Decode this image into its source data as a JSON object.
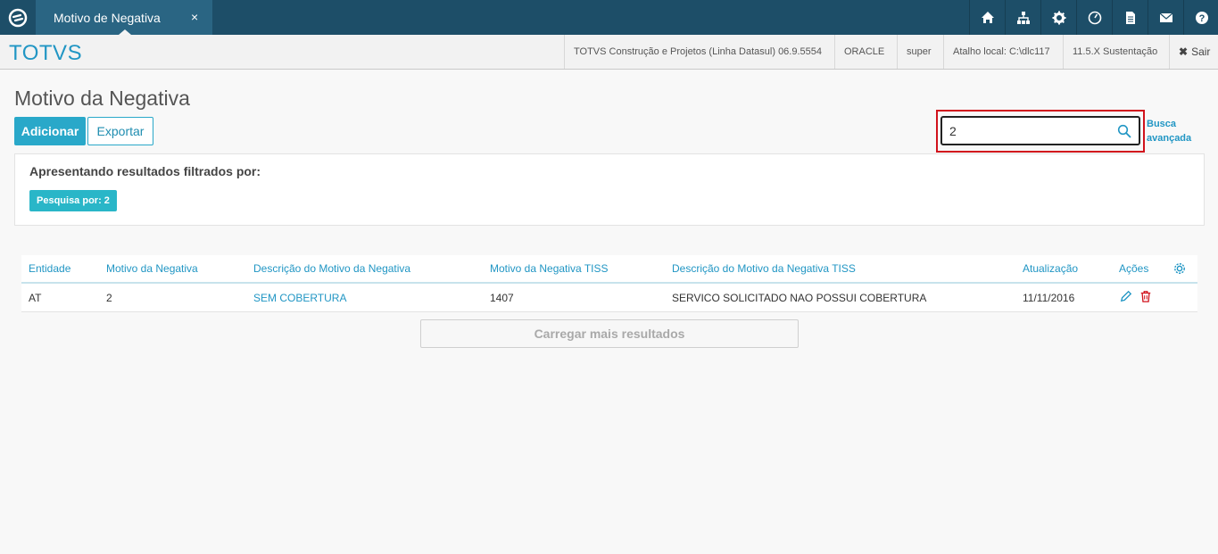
{
  "topbar": {
    "tab_label": "Motivo de Negativa",
    "tab_close": "×",
    "icons": [
      "home-icon",
      "sitemap-icon",
      "gear-icon",
      "dashboard-icon",
      "document-icon",
      "mail-icon",
      "help-icon"
    ]
  },
  "header": {
    "brand": "TOTVS",
    "product": "TOTVS Construção e Projetos (Linha Datasul) 06.9.5554",
    "database": "ORACLE",
    "user": "super",
    "shortcut": "Atalho local: C:\\dlc117",
    "version": "11.5.X Sustentação",
    "logout": "Sair"
  },
  "page": {
    "title": "Motivo da Negativa",
    "add_label": "Adicionar",
    "export_label": "Exportar"
  },
  "search": {
    "value": "2",
    "advanced_line1": "Busca",
    "advanced_line2": "avançada"
  },
  "filter": {
    "title": "Apresentando resultados filtrados por:",
    "badge": "Pesquisa por: 2"
  },
  "table": {
    "headers": [
      "Entidade",
      "Motivo da Negativa",
      "Descrição do Motivo da Negativa",
      "Motivo da Negativa TISS",
      "Descrição do Motivo da Negativa TISS",
      "Atualização",
      "Ações"
    ],
    "rows": [
      [
        "AT",
        "2",
        "SEM COBERTURA",
        "1407",
        "SERVICO SOLICITADO NAO POSSUI COBERTURA",
        "11/11/2016"
      ]
    ]
  },
  "load_more": "Carregar mais resultados",
  "colors": {
    "topbar": "#1d4e68",
    "accent": "#29a8c9",
    "link": "#2196c4",
    "highlight": "#d1121c"
  }
}
